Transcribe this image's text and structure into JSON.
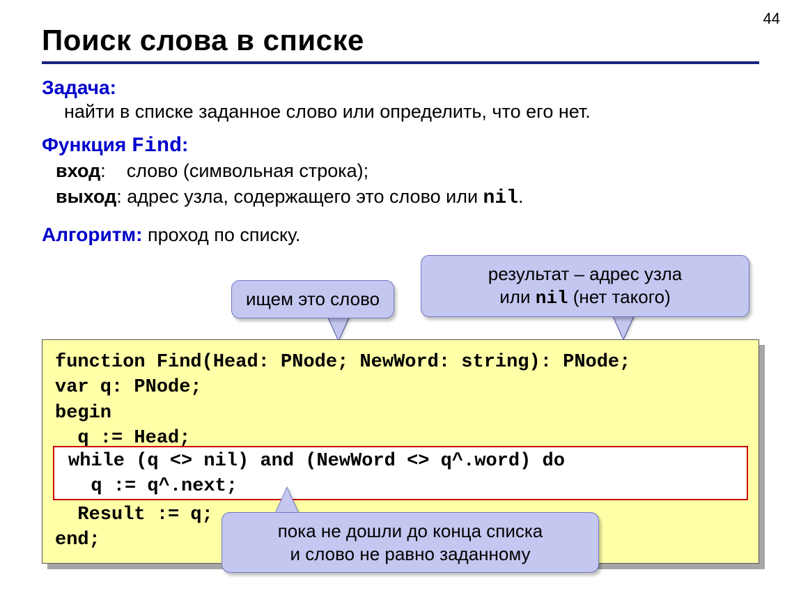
{
  "page_number": "44",
  "title": "Поиск слова в списке",
  "task": {
    "label": "Задача:",
    "text": "найти в списке заданное слово или определить, что его нет."
  },
  "func": {
    "label_prefix": "Функция ",
    "label_name": "Find",
    "label_suffix": ":",
    "input_label": "вход",
    "input_text": ":    слово (символьная строка);",
    "output_label": "выход",
    "output_text_a": ": адрес узла, содержащего это слово или ",
    "output_nil": "nil",
    "output_text_b": "."
  },
  "algo": {
    "label": "Алгоритм:",
    "text": " проход по списку."
  },
  "callouts": {
    "c1": "ищем это слово",
    "c2_a": "результат – адрес узла",
    "c2_b_pre": "или ",
    "c2_b_nil": "nil",
    "c2_b_post": " (нет такого)",
    "c3_a": "пока не дошли до конца списка",
    "c3_b": "и слово не равно заданному"
  },
  "code": {
    "l1": "function Find(Head: PNode; NewWord: string): PNode;",
    "l2": "var q: PNode;",
    "l3": "begin",
    "l4": "  q := Head;",
    "l5": "while (q <> nil) and (NewWord <> q^.word) do",
    "l6": "  q := q^.next;",
    "l7": "  Result := q;",
    "l8": "end;"
  }
}
